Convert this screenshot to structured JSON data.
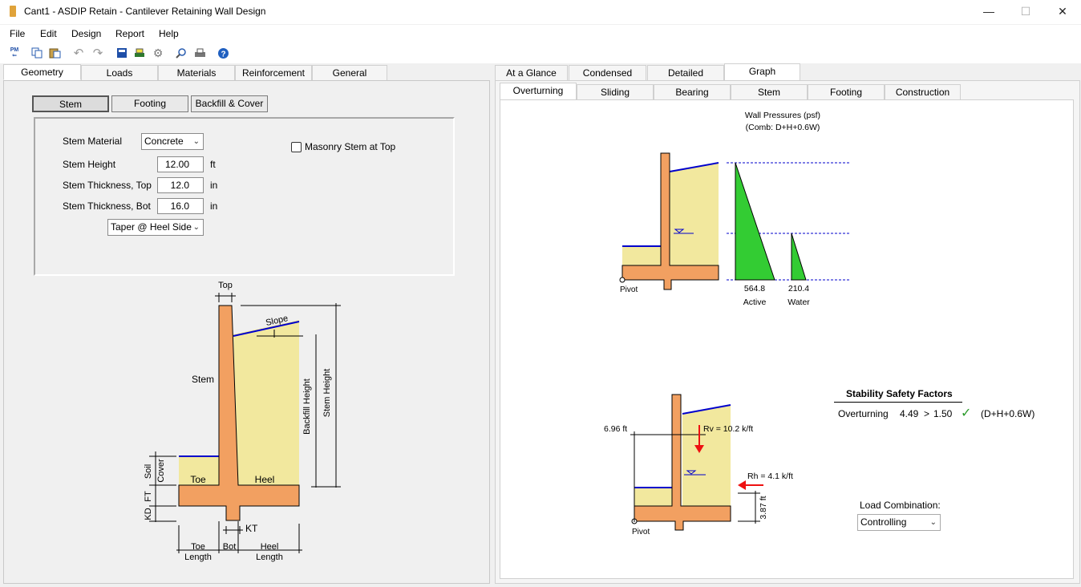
{
  "window": {
    "title": "Cant1 - ASDIP Retain - Cantilever Retaining Wall Design",
    "minimize": "—",
    "maximize": "☐",
    "close": "✕"
  },
  "menu": [
    "File",
    "Edit",
    "Design",
    "Report",
    "Help"
  ],
  "toolbar_icons": [
    "project-manager-icon",
    "copy-icon",
    "paste-icon",
    "undo-icon",
    "redo-icon",
    "calculator-icon",
    "print-setup-icon",
    "settings-icon",
    "zoom-icon",
    "print-icon",
    "help-icon"
  ],
  "toolbar_pm_label": "PM",
  "left_tabs": [
    "Geometry",
    "Loads",
    "Materials",
    "Reinforcement",
    "General"
  ],
  "sub_buttons": [
    "Stem",
    "Footing",
    "Backfill & Cover"
  ],
  "form": {
    "stem_material_label": "Stem Material",
    "stem_material_value": "Concrete",
    "stem_height_label": "Stem Height",
    "stem_height_value": "12.00",
    "stem_height_unit": "ft",
    "stem_thk_top_label": "Stem Thickness, Top",
    "stem_thk_top_value": "12.0",
    "stem_thk_top_unit": "in",
    "stem_thk_bot_label": "Stem Thickness, Bot",
    "stem_thk_bot_value": "16.0",
    "stem_thk_bot_unit": "in",
    "taper_value": "Taper @ Heel Side",
    "masonry_label": "Masonry Stem at Top",
    "masonry_checked": false
  },
  "geometry_diagram": {
    "top": "Top",
    "slope": "Slope",
    "stem": "Stem",
    "backfill_height": "Backfill Height",
    "stem_height": "Stem Height",
    "toe": "Toe",
    "heel": "Heel",
    "soil": "Soil",
    "cover": "Cover",
    "kd": "KD",
    "ft": "FT",
    "kt": "KT",
    "toe_length_1": "Toe",
    "toe_length_2": "Length",
    "bot": "Bot",
    "heel_length_1": "Heel",
    "heel_length_2": "Length"
  },
  "right_tabs": [
    "At a Glance",
    "Condensed",
    "Detailed",
    "Graph"
  ],
  "right_subtabs": [
    "Overturning",
    "Sliding",
    "Bearing",
    "Stem",
    "Footing",
    "Construction"
  ],
  "pressure_diagram": {
    "title": "Wall Pressures (psf)",
    "subtitle": "(Comb: D+H+0.6W)",
    "active_value": "564.8",
    "active_label": "Active",
    "water_value": "210.4",
    "water_label": "Water",
    "pivot": "Pivot"
  },
  "stability_diagram": {
    "height_label": "6.96 ft",
    "rv_label": "Rv = 10.2 k/ft",
    "rh_label": "Rh = 4.1 k/ft",
    "arm_label": "3.87 ft",
    "pivot": "Pivot"
  },
  "safety": {
    "heading": "Stability Safety Factors",
    "row_label": "Overturning",
    "value": "4.49",
    "op": ">",
    "limit": "1.50",
    "check": "✓",
    "combo": "(D+H+0.6W)"
  },
  "load_combination": {
    "label": "Load Combination:",
    "value": "Controlling"
  },
  "colors": {
    "concrete": "#f2a061",
    "soil": "#f2e89e",
    "active": "#33cc33",
    "water_line": "#0000cc",
    "force_arrow": "#ee1111"
  }
}
